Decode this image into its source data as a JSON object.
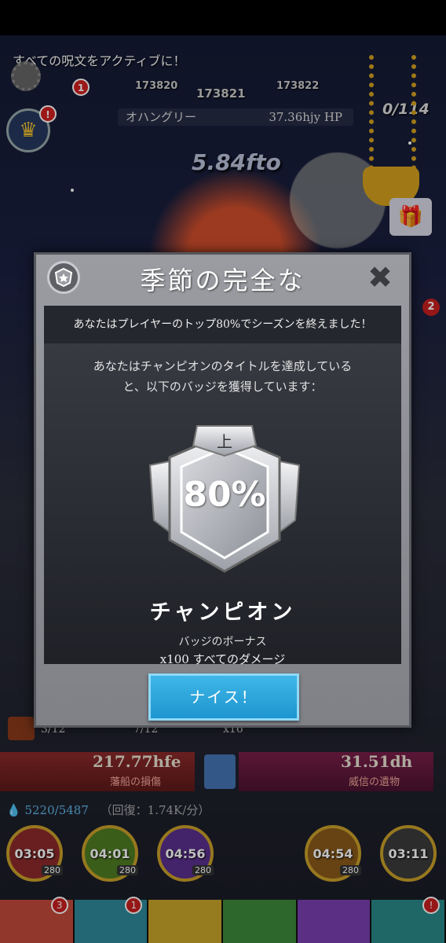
{
  "game": {
    "spell_banner": "すべての呪文をアクティブに！",
    "stage_numbers": [
      "173820",
      "173821",
      "173822"
    ],
    "boss_counter": "0/114",
    "enemy_name": "オハングリー",
    "enemy_hp": "37.36hjy HP",
    "tap_damage": "5.84fto",
    "notification_counts": {
      "top_left": "1",
      "side": "2"
    }
  },
  "modal": {
    "title": "季節の完全な",
    "close_symbol": "✖",
    "subtitle": "あなたはプレイヤーのトップ80%でシーズンを終えました！",
    "description_line1": "あなたはチャンピオンのタイトルを達成している",
    "description_line2": "と、以下のバッジを獲得しています：",
    "badge_tier_char": "上",
    "badge_percent": "80%",
    "rank_title": "チャンピオン",
    "bonus_label": "バッジのボーナス",
    "bonus_value": "x100 すべてのダメージ",
    "confirm_button": "ナイス！"
  },
  "stats": {
    "counters": [
      "3/12",
      "7/12",
      "x16"
    ],
    "ship_damage_value": "217.77hfe",
    "ship_damage_label": "藩船の損傷",
    "relic_value": "31.51dh",
    "relic_label": "威信の遺物",
    "mana": "5220/5487",
    "mana_regen": "（回復：1.74K/分）"
  },
  "skills": [
    {
      "timer": "03:05",
      "cost": "280",
      "color": "#8c2a2a"
    },
    {
      "timer": "04:01",
      "cost": "280",
      "color": "#4f7d23"
    },
    {
      "timer": "04:56",
      "cost": "280",
      "color": "#5a2f8c"
    },
    {
      "timer": "04:54",
      "cost": "280",
      "color": "#8a5a1a"
    },
    {
      "timer": "03:11",
      "cost": "",
      "color": "#3b3b3b"
    }
  ],
  "tabs": [
    {
      "color": "#c24a3a",
      "badge": "3"
    },
    {
      "color": "#2e8a9a",
      "badge": "1"
    },
    {
      "color": "#c9a52a",
      "badge": ""
    },
    {
      "color": "#3c8a3a",
      "badge": ""
    },
    {
      "color": "#7a3fb0",
      "badge": ""
    },
    {
      "color": "#2a8a8a",
      "badge": "!"
    }
  ]
}
